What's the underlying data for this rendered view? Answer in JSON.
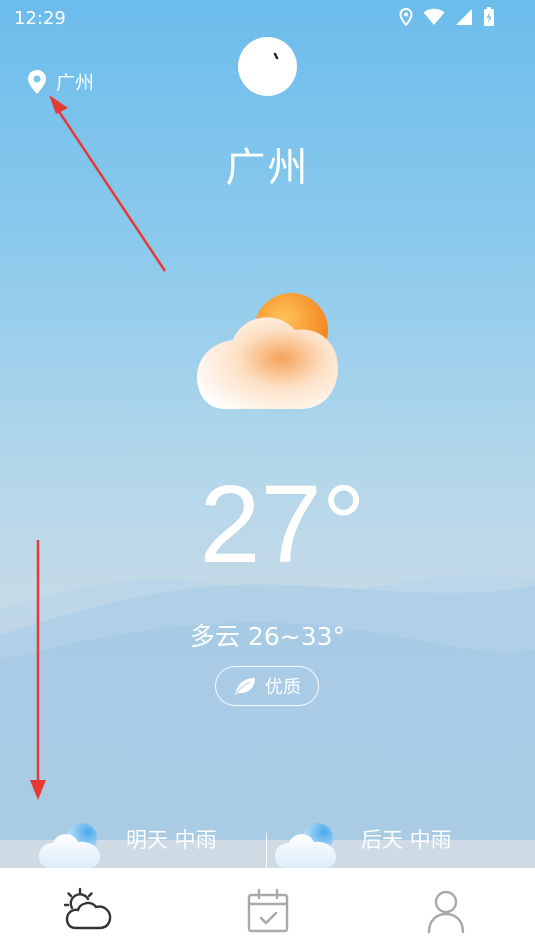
{
  "status_bar": {
    "time": "12:29"
  },
  "location": {
    "label": "广州"
  },
  "city": {
    "name": "广州"
  },
  "current": {
    "temperature": "27°",
    "condition_range": "多云 26~33°",
    "air_quality": "优质"
  },
  "forecast": [
    {
      "label": "明天 中雨",
      "icon": "light-rain-cloud-icon"
    },
    {
      "label": "后天 中雨",
      "icon": "light-rain-cloud-icon"
    }
  ],
  "tabs": [
    {
      "icon": "weather-tab-icon",
      "active": true
    },
    {
      "icon": "calendar-tab-icon",
      "active": false
    },
    {
      "icon": "profile-tab-icon",
      "active": false
    }
  ],
  "colors": {
    "sky_top": "#6bbcec",
    "sky_bottom": "#cfdbe5",
    "arrow": "#e53935",
    "sun": "#f7941d"
  }
}
